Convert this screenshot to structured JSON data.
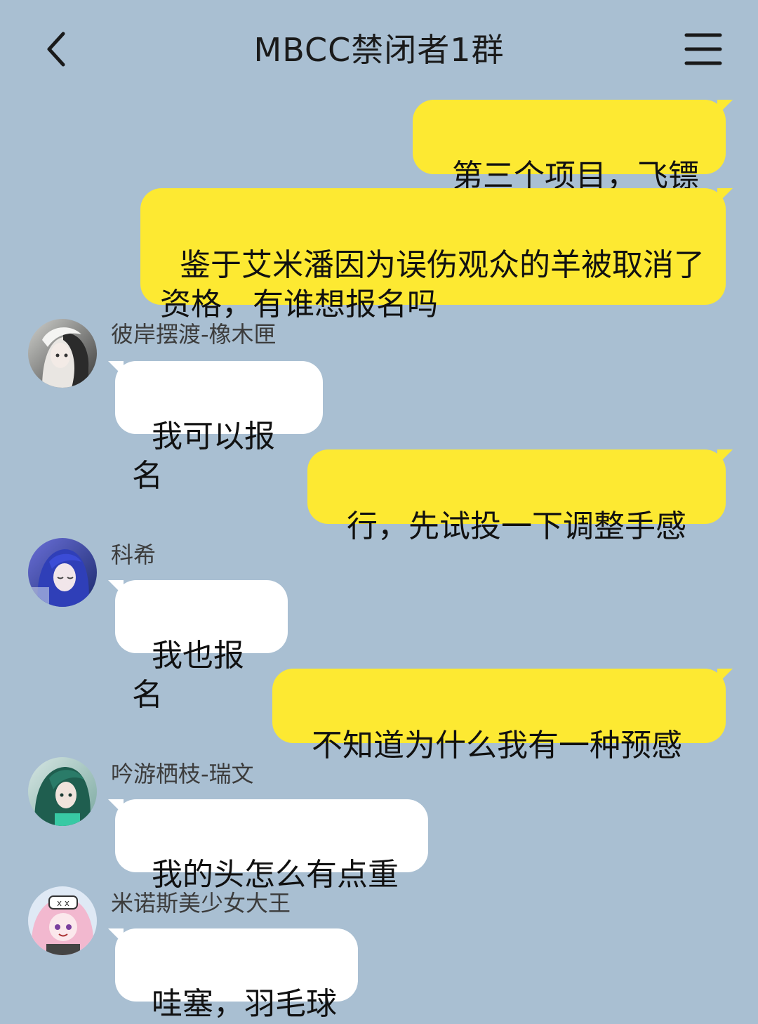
{
  "header": {
    "title": "MBCC禁闭者1群"
  },
  "messages": [
    {
      "from": "me",
      "text": "第三个项目，飞镖"
    },
    {
      "from": "me",
      "text": "鉴于艾米潘因为误伤观众的羊被取消了资格，有谁想报名吗"
    },
    {
      "from": "them",
      "sender": "彼岸摆渡-橡木匣",
      "text": "我可以报名"
    },
    {
      "from": "me",
      "text": "行，先试投一下调整手感"
    },
    {
      "from": "them",
      "sender": "科希",
      "text": "我也报名"
    },
    {
      "from": "me",
      "text": "不知道为什么我有一种预感"
    },
    {
      "from": "them",
      "sender": "吟游栖枝-瑞文",
      "text": "我的头怎么有点重"
    },
    {
      "from": "them",
      "sender": "米诺斯美少女大王",
      "text": "哇塞，羽毛球"
    }
  ],
  "colors": {
    "background": "#a9bfd2",
    "my_bubble": "#fde932",
    "their_bubble": "#ffffff"
  },
  "icons": {
    "back": "chevron-left-icon",
    "menu": "hamburger-menu-icon"
  }
}
